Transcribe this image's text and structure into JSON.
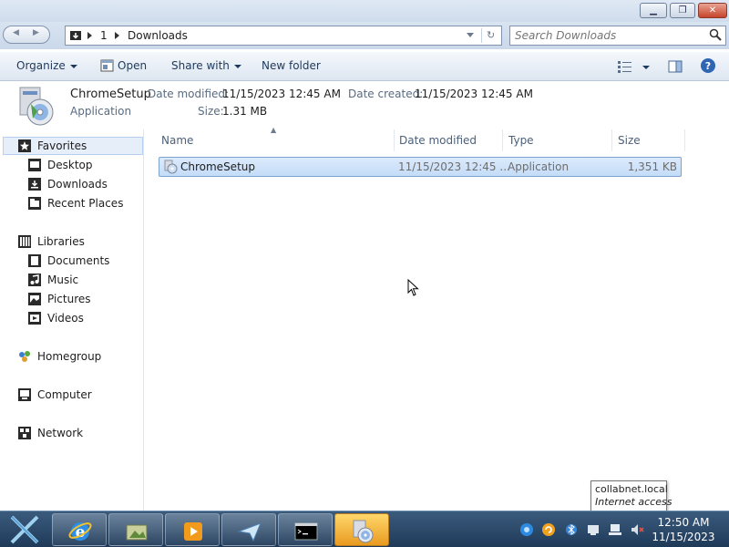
{
  "address_bar": {
    "crumbs": [
      "1",
      "Downloads"
    ],
    "search_placeholder": "Search Downloads"
  },
  "toolbar": {
    "organize": "Organize",
    "open": "Open",
    "share_with": "Share with",
    "new_folder": "New folder"
  },
  "details": {
    "name": "ChromeSetup",
    "type": "Application",
    "date_modified_label": "Date modified:",
    "date_modified": "11/15/2023 12:45 AM",
    "date_created_label": "Date created:",
    "date_created": "11/15/2023 12:45 AM",
    "size_label": "Size:",
    "size": "1.31 MB"
  },
  "nav": {
    "favorites": "Favorites",
    "desktop": "Desktop",
    "downloads": "Downloads",
    "recent_places": "Recent Places",
    "libraries": "Libraries",
    "documents": "Documents",
    "music": "Music",
    "pictures": "Pictures",
    "videos": "Videos",
    "homegroup": "Homegroup",
    "computer": "Computer",
    "network": "Network"
  },
  "columns": {
    "name": "Name",
    "date_modified": "Date modified",
    "type": "Type",
    "size": "Size"
  },
  "files": [
    {
      "name": "ChromeSetup",
      "date_modified": "11/15/2023 12:45 ...",
      "type": "Application",
      "size": "1,351 KB"
    }
  ],
  "tooltip": {
    "network_name": "collabnet.local",
    "status": "Internet access"
  },
  "clock": {
    "time": "12:50 AM",
    "date": "11/15/2023"
  },
  "colors": {
    "selection": "#cfe2fa",
    "taskbar": "#2b4a6c",
    "active_task": "#f0b43c"
  }
}
